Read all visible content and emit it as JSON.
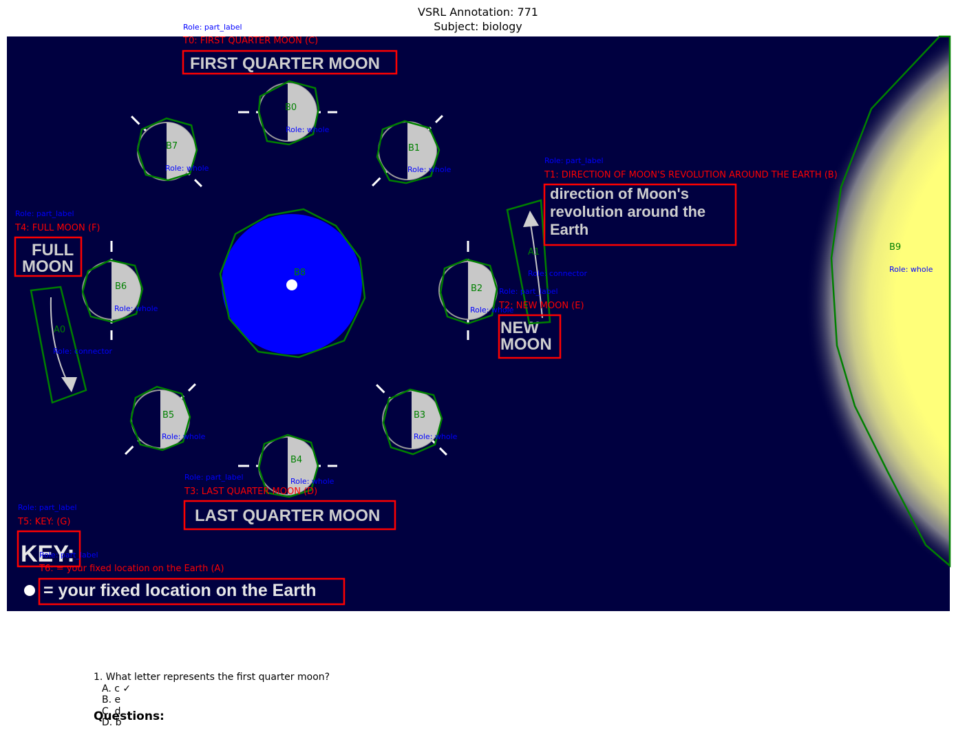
{
  "header": {
    "title_line1": "VSRL Annotation: 771",
    "title_line2": "Subject: biology"
  },
  "colors": {
    "background": "#000040",
    "earth": "#0000ff",
    "sun": "#ffff7a",
    "moon_lit": "#c8c8c8",
    "polygon_stroke": "#008000",
    "text_box_stroke": "#ff0000",
    "text_label": "#ff0000",
    "role_label": "#0000ff"
  },
  "image_text": {
    "first_quarter": "FIRST QUARTER MOON",
    "direction": [
      "direction of Moon's",
      "revolution around the",
      "Earth"
    ],
    "full_moon": [
      "FULL",
      "MOON"
    ],
    "new_moon": [
      "NEW",
      "MOON"
    ],
    "last_quarter": "LAST QUARTER MOON",
    "key": "KEY:",
    "location": "= your fixed location on the Earth"
  },
  "text_boxes": [
    {
      "label": "T0: FIRST QUARTER MOON (C)",
      "role": "Role: part_label"
    },
    {
      "label": "T1: DIRECTION OF MOON'S REVOLUTION AROUND THE EARTH (B)",
      "role": "Role: part_label"
    },
    {
      "label": "T2: NEW MOON (E)",
      "role": "Role: part_label"
    },
    {
      "label": "T3: LAST QUARTER MOON (D)",
      "role": "Role: part_label"
    },
    {
      "label": "T4: FULL MOON (F)",
      "role": "Role: part_label"
    },
    {
      "label": "T5: KEY: (G)",
      "role": "Role: part_label"
    },
    {
      "label": "T6: = your fixed location on the Earth (A)",
      "role": "Role: part_label"
    }
  ],
  "blobs": [
    {
      "id": "B0",
      "role": "Role: whole"
    },
    {
      "id": "B1",
      "role": "Role: whole"
    },
    {
      "id": "B2",
      "role": "Role: whole"
    },
    {
      "id": "B3",
      "role": "Role: whole"
    },
    {
      "id": "B4",
      "role": "Role: whole"
    },
    {
      "id": "B5",
      "role": "Role: whole"
    },
    {
      "id": "B6",
      "role": "Role: whole"
    },
    {
      "id": "B7",
      "role": "Role: whole"
    },
    {
      "id": "B8",
      "role": ""
    },
    {
      "id": "B9",
      "role": "Role: whole"
    }
  ],
  "arrows": [
    {
      "id": "A0",
      "role": "Role: connector"
    },
    {
      "id": "A1",
      "role": "Role: connector"
    }
  ],
  "questions": [
    {
      "text": "1. What letter represents the first quarter moon?",
      "options": [
        "A. c ✓",
        "B. e",
        "C. d",
        "D. b"
      ]
    }
  ],
  "questions_heading": "Questions:"
}
